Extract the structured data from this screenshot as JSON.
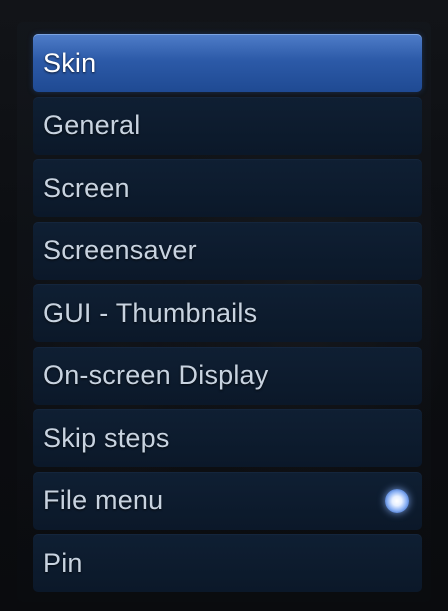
{
  "menu": {
    "items": [
      {
        "label": "Skin",
        "selected": true
      },
      {
        "label": "General"
      },
      {
        "label": "Screen"
      },
      {
        "label": "Screensaver"
      },
      {
        "label": "GUI - Thumbnails"
      },
      {
        "label": "On-screen Display"
      },
      {
        "label": "Skip steps"
      },
      {
        "label": "File menu",
        "indicator": "radio-on-icon"
      },
      {
        "label": "Pin"
      }
    ]
  },
  "colors": {
    "selected_item": "#2c5aa8",
    "item_background": "#0f1f33",
    "label_text": "#c8d3e0",
    "indicator_glow": "#8fb4f5"
  }
}
